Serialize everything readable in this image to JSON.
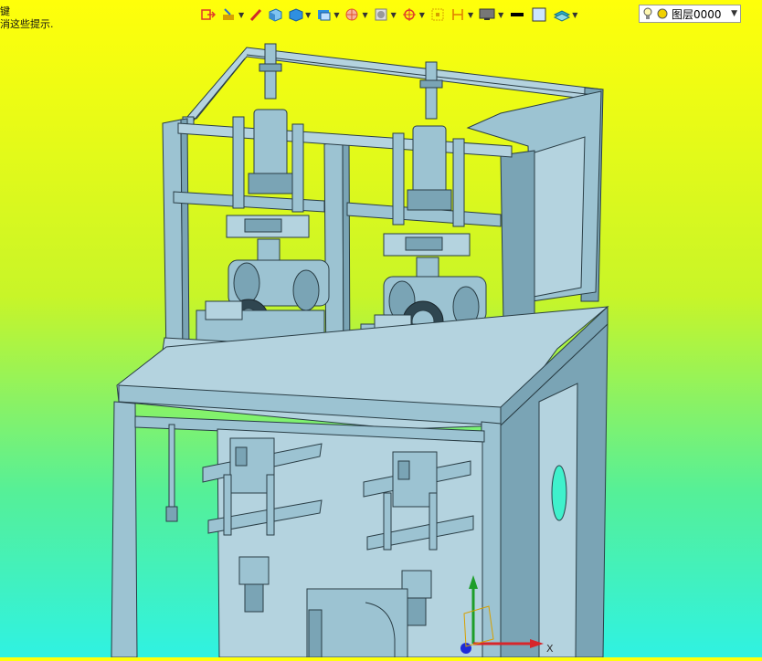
{
  "hint": {
    "line1": "键",
    "line2": "消这些提示."
  },
  "toolbar": {
    "buttons": [
      {
        "name": "exit-sketch-icon",
        "color": "#e03a2a"
      },
      {
        "name": "sketch-tools-icon",
        "color": "#d7a000"
      },
      {
        "name": "pencil-icon",
        "color": "#d02a2a"
      },
      {
        "name": "solid-box-icon",
        "color": "#2f8fe0"
      },
      {
        "name": "view-cube-icon",
        "color": "#2f8fe0"
      },
      {
        "name": "display-style-icon",
        "color": "#2f8fe0"
      },
      {
        "name": "section-view-icon",
        "color": "#e0502a"
      },
      {
        "name": "render-tools-icon",
        "color": "#888888"
      },
      {
        "name": "coordinate-icon",
        "color": "#e03a2a"
      },
      {
        "name": "bounding-box-icon",
        "color": "#d7a000"
      },
      {
        "name": "dimension-icon",
        "color": "#e07a00"
      },
      {
        "name": "monitor-icon",
        "color": "#555555"
      },
      {
        "name": "line-color-icon",
        "color": "#000000"
      },
      {
        "name": "fill-color-icon",
        "color": "#cce6ff"
      },
      {
        "name": "layer-manager-icon",
        "color": "#2ab0c8"
      }
    ]
  },
  "layer": {
    "value": "图层0000"
  },
  "colors": {
    "model_fill": "#9cc3d2",
    "model_dark": "#5e8a9c",
    "model_line": "#2a3e46"
  }
}
